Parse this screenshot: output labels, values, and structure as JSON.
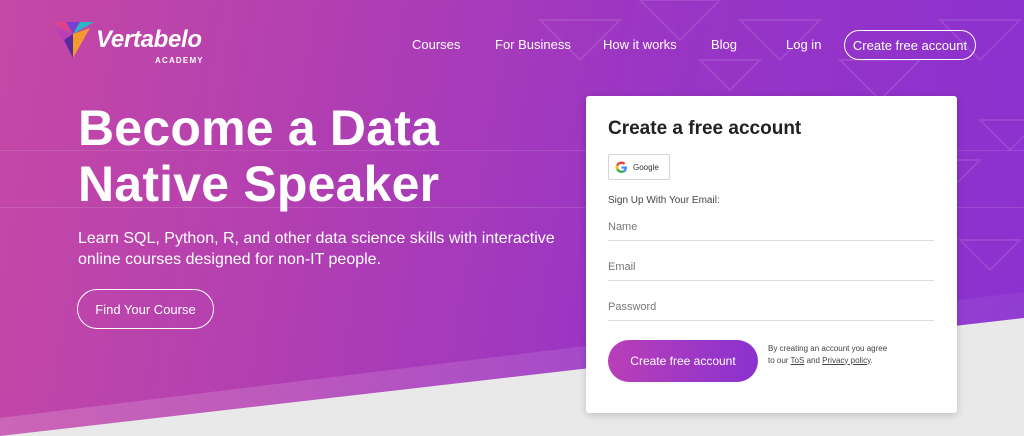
{
  "brand": {
    "name": "Vertabelo",
    "sub": "ACADEMY",
    "colors": [
      "#e2418a",
      "#7a3fd0",
      "#2bb6c4",
      "#f29a2e"
    ]
  },
  "nav": {
    "courses": "Courses",
    "business": "For Business",
    "how": "How it works",
    "blog": "Blog",
    "login": "Log in",
    "cta": "Create free account"
  },
  "hero": {
    "headline_line1": "Become a Data",
    "headline_line2": "Native Speaker",
    "subhead": "Learn SQL, Python, R, and other data science skills with interactive online courses designed for non-IT people.",
    "button": "Find Your Course"
  },
  "signup": {
    "title": "Create a free account",
    "google_label": "Google",
    "email_label": "Sign Up With Your Email:",
    "name_placeholder": "Name",
    "email_placeholder": "Email",
    "password_placeholder": "Password",
    "submit": "Create free account",
    "terms_prefix": "By creating an account you agree to our",
    "tos": "ToS",
    "and": "and",
    "privacy": "Privacy policy",
    "period": "."
  },
  "colors": {
    "accent": "#9a35c4",
    "hero_start": "#c548a6",
    "hero_end": "#8a31d0"
  }
}
